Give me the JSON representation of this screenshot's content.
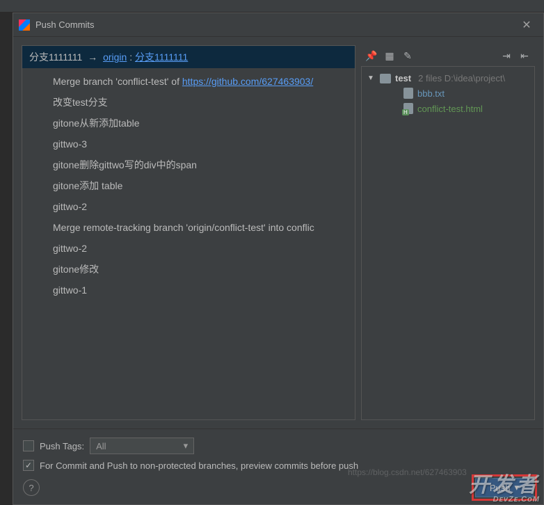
{
  "dialog": {
    "title": "Push Commits"
  },
  "branch": {
    "local": "分支1111111",
    "remote_name": "origin",
    "remote_branch": "分支1111111"
  },
  "commits": [
    {
      "text": "Merge branch 'conflict-test' of ",
      "link": "https://github.com/627463903/"
    },
    {
      "text": "改变test分支"
    },
    {
      "text": "gitone从新添加table"
    },
    {
      "text": "gittwo-3"
    },
    {
      "text": "gitone删除gittwo写的div中的span"
    },
    {
      "text": "gitone添加 table"
    },
    {
      "text": "gittwo-2"
    },
    {
      "text": "Merge remote-tracking branch 'origin/conflict-test' into conflic"
    },
    {
      "text": "gittwo-2"
    },
    {
      "text": "gitone修改"
    },
    {
      "text": "gittwo-1"
    }
  ],
  "files": {
    "root": "test",
    "meta": "2 files  D:\\idea\\project\\",
    "items": [
      {
        "name": "bbb.txt",
        "status": "modified"
      },
      {
        "name": "conflict-test.html",
        "status": "new"
      }
    ]
  },
  "options": {
    "push_tags_label": "Push Tags:",
    "push_tags_value": "All",
    "preview_label": "For Commit and Push to non-protected branches, preview commits before push"
  },
  "buttons": {
    "push": "Push"
  },
  "watermarks": {
    "url": "https://blog.csdn.net/627463903",
    "brand": "开发者",
    "brand_sub": "DᴇᴠZᴇ.CᴏM"
  }
}
